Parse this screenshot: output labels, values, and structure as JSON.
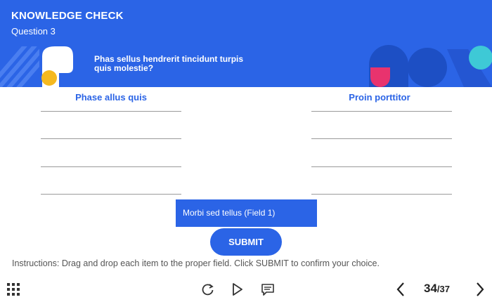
{
  "header": {
    "title": "KNOWLEDGE CHECK",
    "subtitle": "Question 3",
    "question": "Phas sellus hendrerit tincidunt turpis quis molestie?"
  },
  "columns": [
    {
      "title": "Phase allus quis",
      "drop_slots": 4
    },
    {
      "title": "Proin porttitor",
      "drop_slots": 4
    }
  ],
  "drag_item": {
    "label": "Morbi sed tellus (Field 1)"
  },
  "submit_label": "SUBMIT",
  "instructions": {
    "prefix": "Instructions",
    "text": ": Drag and drop each item to the proper field. Click SUBMIT to confirm your choice."
  },
  "footer": {
    "icons": [
      "grid-menu-icon",
      "replay-icon",
      "play-icon",
      "comment-icon",
      "prev-arrow-icon",
      "next-arrow-icon"
    ],
    "current_page": "34",
    "total_pages": "/37"
  },
  "colors": {
    "accent": "#2b64e6",
    "pink": "#e8336e",
    "yellow": "#f5b920",
    "teal": "#3ec9d6",
    "dark_blue": "#1d4fc4"
  }
}
